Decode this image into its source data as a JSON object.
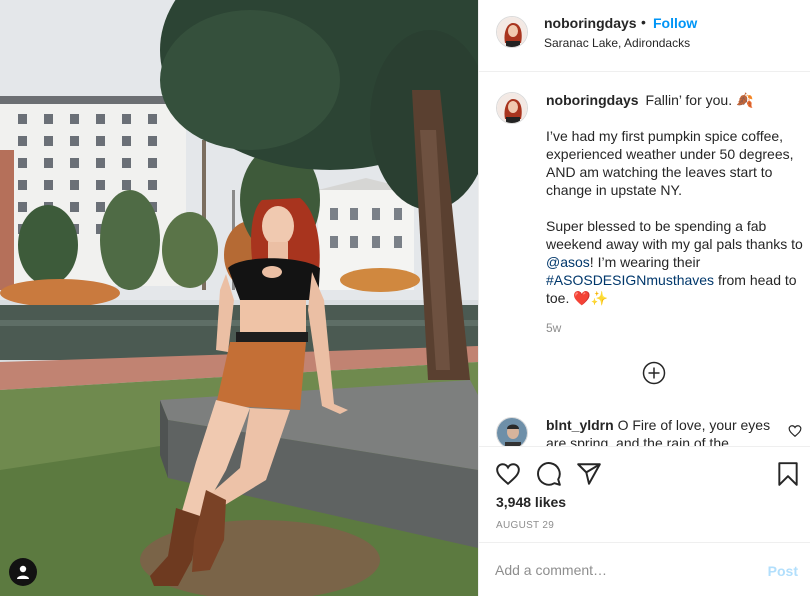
{
  "post": {
    "author": "noboringdays",
    "follow_label": "Follow",
    "separator": "•",
    "location": "Saranac Lake, Adirondacks"
  },
  "caption": {
    "username": "noboringdays",
    "line1": "Fallin’ for you. 🍂",
    "para2": "I’ve had my first pumpkin spice coffee, experienced weather under 50 degrees, AND am watching the leaves start to change in upstate NY.",
    "para3_start": "Super blessed to be spending a fab weekend away with my gal pals thanks to ",
    "mention": "@asos",
    "para3_mid": "! I’m wearing their ",
    "hashtag": "#ASOSDESIGNmusthaves",
    "para3_end": " from head to toe. ❤️✨",
    "age": "5w"
  },
  "comment": {
    "username": "blnt_yldrn",
    "text": "O Fire of love, your eyes are spring, and the rain of the"
  },
  "actions": {
    "likes": "3,948 likes",
    "date": "AUGUST 29"
  },
  "add_comment": {
    "placeholder": "Add a comment…",
    "post_label": "Post"
  },
  "icons": [
    "user-tag-icon",
    "heart-icon",
    "comment-bubble-icon",
    "share-plane-icon",
    "bookmark-icon",
    "plus-circle-icon",
    "small-heart-icon"
  ],
  "colors": {
    "link_blue": "#0095f6",
    "post_disabled": "#b2dffc",
    "muted": "#8e8e8e",
    "text": "#262626"
  }
}
